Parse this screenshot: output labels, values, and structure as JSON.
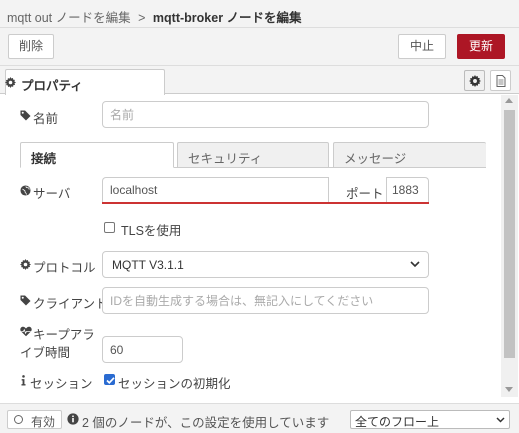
{
  "breadcrumb": {
    "parent": "mqtt out ノードを編集",
    "separator": ">",
    "current": "mqtt-broker ノードを編集"
  },
  "toolbar": {
    "delete_label": "削除",
    "cancel_label": "中止",
    "update_label": "更新"
  },
  "property_tab": {
    "label": "プロパティ"
  },
  "form": {
    "name": {
      "label": "名前",
      "placeholder": "名前",
      "value": ""
    },
    "tabs": [
      {
        "label": "接続"
      },
      {
        "label": "セキュリティ"
      },
      {
        "label": "メッセージ"
      }
    ],
    "server": {
      "label": "サーバ",
      "value": "localhost"
    },
    "port": {
      "label": "ポート",
      "value": "1883"
    },
    "tls": {
      "label": "TLSを使用",
      "checked": false
    },
    "protocol": {
      "label": "プロトコル",
      "value": "MQTT V3.1.1"
    },
    "client": {
      "label": "クライアント",
      "placeholder": "IDを自動生成する場合は、無記入にしてください",
      "value": ""
    },
    "keepalive": {
      "label_line1": "キープアラ",
      "label_line2": "イブ時間",
      "value": "60"
    },
    "session": {
      "label": "セッション",
      "checkbox_label": "セッションの初期化",
      "checked": true
    }
  },
  "footer": {
    "enabled_label": "有効",
    "usage_text": "2 個のノードが、この設定を使用しています",
    "scope_value": "全てのフロー上"
  },
  "colors": {
    "update_button": "#ad1625",
    "error_underline": "#cc3333",
    "checkbox_checked": "#2a6bd1"
  }
}
